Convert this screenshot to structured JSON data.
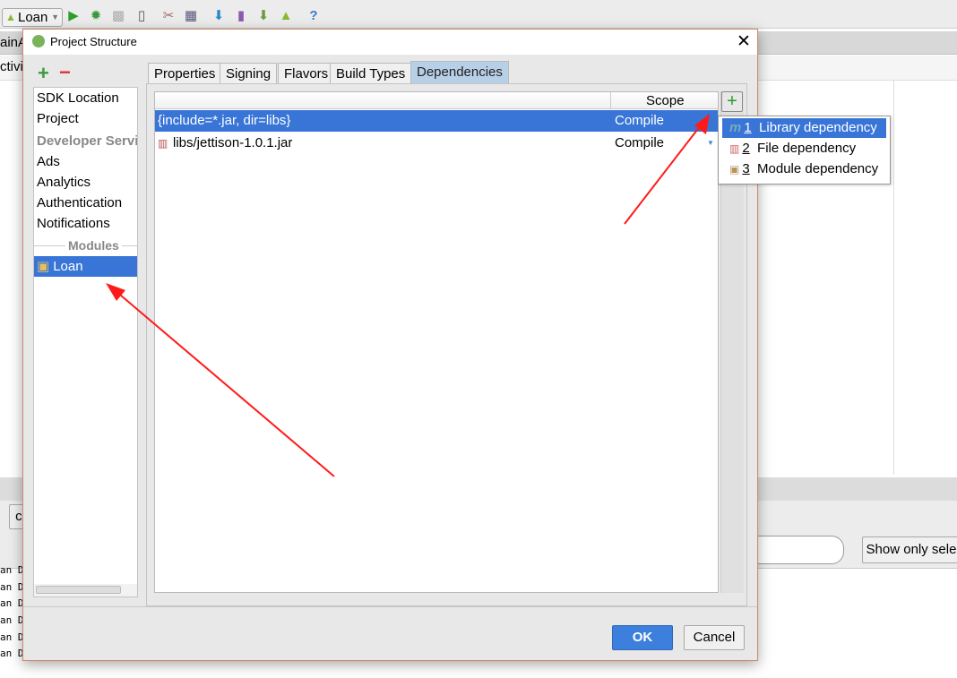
{
  "ide": {
    "run_config": "Loan",
    "editor_tab": "ainA",
    "editor_line": "ctivi",
    "bottom_button": "co",
    "show_only_button": "Show only sele",
    "log_lines": [
      "an D/",
      "an D/",
      "an D/",
      "an D/",
      "an D/",
      "an D/"
    ],
    "toolbar_icons": [
      "run-icon",
      "debug-icon",
      "attach-icon",
      "device-icon",
      "project-structure-icon",
      "sdk-manager-icon",
      "sync-icon",
      "avd-icon",
      "android-download-icon",
      "android-icon",
      "help-icon"
    ]
  },
  "dialog": {
    "title": "Project Structure",
    "add_label": "+",
    "remove_label": "−",
    "left_items": [
      {
        "label": "SDK Location",
        "type": "item"
      },
      {
        "label": "Project",
        "type": "item"
      },
      {
        "label": "Developer Servic",
        "type": "header"
      },
      {
        "label": "Ads",
        "type": "item"
      },
      {
        "label": "Analytics",
        "type": "item"
      },
      {
        "label": "Authentication",
        "type": "item"
      },
      {
        "label": "Notifications",
        "type": "item"
      }
    ],
    "modules_header": "Modules",
    "module": "Loan",
    "tabs": [
      "Properties",
      "Signing",
      "Flavors",
      "Build Types",
      "Dependencies"
    ],
    "active_tab": "Dependencies",
    "table": {
      "columns": [
        "",
        "Scope"
      ],
      "rows": [
        {
          "name": "{include=*.jar, dir=libs}",
          "scope": "Compile",
          "selected": true
        },
        {
          "name": "libs/jettison-1.0.1.jar",
          "scope": "Compile",
          "selected": false
        }
      ]
    },
    "add_dep_label": "+",
    "menu": [
      {
        "num": "1",
        "label": "Library dependency",
        "icon": "library-icon"
      },
      {
        "num": "2",
        "label": "File dependency",
        "icon": "jar-file-icon"
      },
      {
        "num": "3",
        "label": "Module dependency",
        "icon": "module-folder-icon"
      }
    ],
    "ok": "OK",
    "cancel": "Cancel"
  },
  "colors": {
    "selection": "#3875d7",
    "accent_green": "#3c9b3c",
    "annotation_arrow": "#ff1a1a"
  }
}
